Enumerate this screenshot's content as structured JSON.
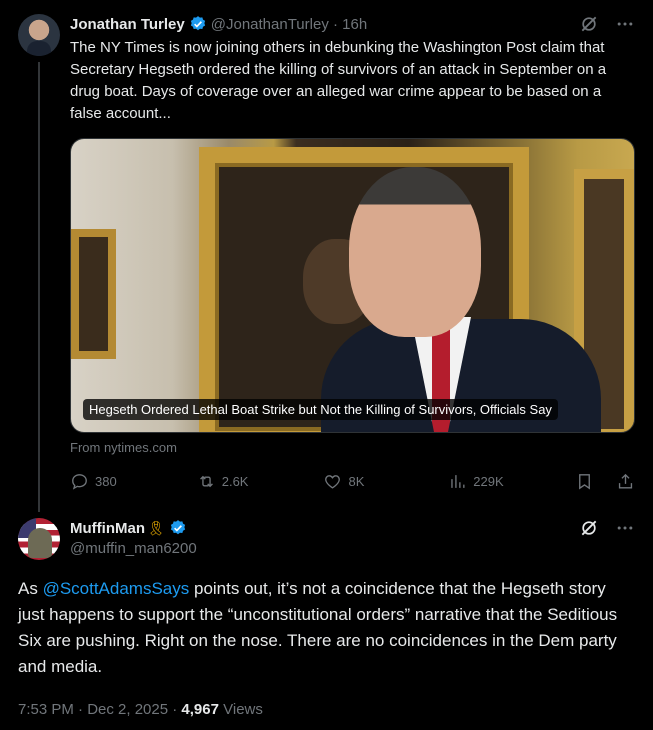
{
  "tweet": {
    "author_name": "Jonathan Turley",
    "handle_time": "@JonathanTurley · 16h",
    "text": "The NY Times is now joining others in debunking the Washington Post claim that Secretary Hegseth ordered the killing of survivors of an attack in September on a drug boat. Days of coverage over an alleged war crime appear to be based on a false account...",
    "card": {
      "caption": "Hegseth Ordered Lethal Boat Strike but Not the Killing of Survivors, Officials Say",
      "source": "From nytimes.com"
    },
    "actions": {
      "replies": "380",
      "reposts": "2.6K",
      "likes": "8K",
      "views": "229K"
    }
  },
  "reply": {
    "author_name": "MuffinMan",
    "ribbon": "🎗",
    "handle": "@muffin_man6200",
    "mention": "@ScottAdamsSays",
    "text_rest": " points out, it’s not a coincidence that the Hegseth story just happens to support the “unconstitutional orders” narrative that the Seditious Six are pushing. Right on the nose. There are no coincidences in the Dem party and media.",
    "text_prefix": "As ",
    "timestamp": "7:53 PM · Dec 2, 2025 · ",
    "views_count": "4,967",
    "views_label": " Views"
  },
  "colors": {
    "background": "#000000",
    "text": "#e7e9ea",
    "secondary": "#71767b",
    "accent": "#1d9bf0"
  },
  "icons": [
    "verified-badge-icon",
    "grok-icon",
    "more-icon",
    "reply-icon",
    "repost-icon",
    "like-icon",
    "views-icon",
    "bookmark-icon",
    "share-icon"
  ]
}
